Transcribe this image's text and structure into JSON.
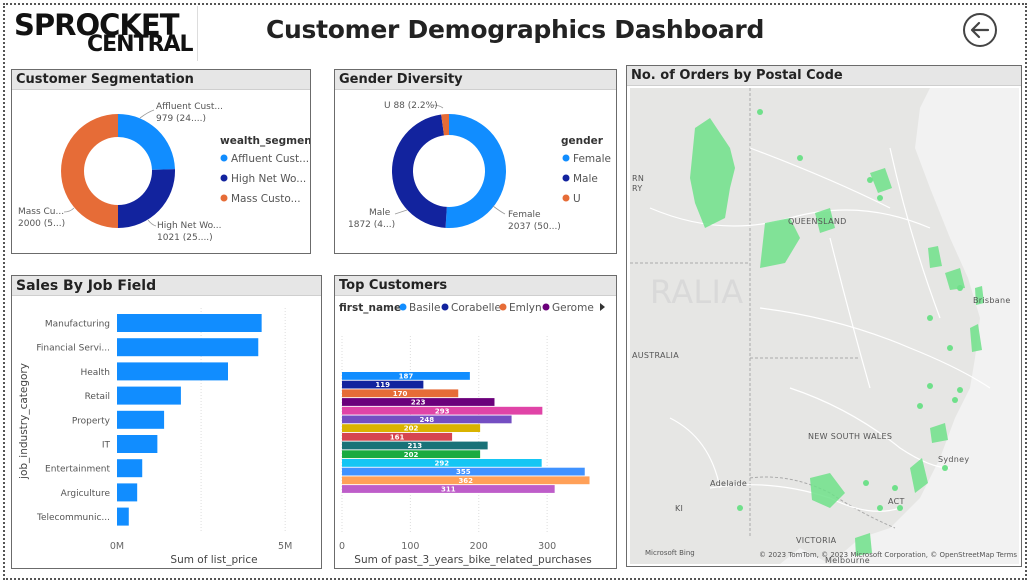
{
  "header": {
    "logo_line1": "SPROCKET",
    "logo_line2": "CENTRAL",
    "title": "Customer Demographics Dashboard"
  },
  "colors": {
    "blue": "#118DFF",
    "navy": "#12239E",
    "orange": "#E66C37",
    "map_point": "#6FE08A"
  },
  "segmentation": {
    "title": "Customer Segmentation",
    "legend_title": "wealth_segment",
    "legend": [
      "Affluent Cust...",
      "High Net Wo...",
      "Mass Custo..."
    ],
    "labels": [
      {
        "name": "Affluent Cust...",
        "value": "979 (24....)"
      },
      {
        "name": "High Net Wo...",
        "value": "1021 (25....)"
      },
      {
        "name": "Mass Cu...",
        "value": "2000 (5...)"
      }
    ]
  },
  "gender": {
    "title": "Gender Diversity",
    "legend_title": "gender",
    "legend": [
      "Female",
      "Male",
      "U"
    ],
    "label_u": "U 88 (2.2%)",
    "label_male_name": "Male",
    "label_male_value": "1872 (4...)",
    "label_female_name": "Female",
    "label_female_value": "2037 (50...)"
  },
  "jobs": {
    "title": "Sales By Job Field",
    "ylabel": "job_industry_category",
    "xlabel": "Sum of list_price",
    "ticks": [
      "0M",
      "5M"
    ]
  },
  "top_customers": {
    "title": "Top Customers",
    "legend_title": "first_name",
    "legend": [
      {
        "name": "Basile",
        "color": "#118DFF"
      },
      {
        "name": "Corabelle",
        "color": "#12239E"
      },
      {
        "name": "Emlyn",
        "color": "#E66C37"
      },
      {
        "name": "Gerome",
        "color": "#6B007B"
      }
    ],
    "xlabel": "Sum of past_3_years_bike_related_purchases",
    "ticks": [
      "0",
      "100",
      "200",
      "300"
    ]
  },
  "map": {
    "title": "No. of Orders by Postal Code",
    "labels": [
      "QUEENSLAND",
      "Brisbane",
      "AUSTRALIA",
      "NEW SOUTH WALES",
      "Sydney",
      "Adelaide",
      "ACT",
      "VICTORIA",
      "Melbourne",
      "RALIA",
      "RN",
      "RY",
      "KI"
    ],
    "credit_left": "Microsoft Bing",
    "credit_right": "© 2023 TomTom, © 2023 Microsoft Corporation, © OpenStreetMap  Terms"
  },
  "chart_data": [
    {
      "type": "pie",
      "title": "Customer Segmentation",
      "categories": [
        "Affluent Customer",
        "High Net Worth",
        "Mass Customer"
      ],
      "values": [
        979,
        1021,
        2000
      ]
    },
    {
      "type": "pie",
      "title": "Gender Diversity",
      "categories": [
        "Female",
        "Male",
        "U"
      ],
      "values": [
        2037,
        1872,
        88
      ]
    },
    {
      "type": "bar",
      "title": "Sales By Job Field",
      "categories": [
        "Manufacturing",
        "Financial Servi...",
        "Health",
        "Retail",
        "Property",
        "IT",
        "Entertainment",
        "Argiculture",
        "Telecommunic..."
      ],
      "values": [
        4.3,
        4.2,
        3.3,
        1.9,
        1.4,
        1.2,
        0.75,
        0.6,
        0.35
      ],
      "xlabel": "Sum of list_price",
      "ylabel": "job_industry_category",
      "xlim": [
        0,
        5.5
      ]
    },
    {
      "type": "bar",
      "title": "Top Customers",
      "values": [
        187,
        119,
        170,
        223,
        293,
        248,
        202,
        161,
        213,
        202,
        292,
        355,
        362,
        311
      ],
      "colors": [
        "#118DFF",
        "#12239E",
        "#E66C37",
        "#6B007B",
        "#E044A7",
        "#744EC2",
        "#D9B300",
        "#D64550",
        "#197278",
        "#1AAB40",
        "#15C6F4",
        "#4092FF",
        "#FFA058",
        "#BE5DC9"
      ],
      "xlabel": "Sum of past_3_years_bike_related_purchases",
      "xlim": [
        0,
        370
      ]
    }
  ]
}
